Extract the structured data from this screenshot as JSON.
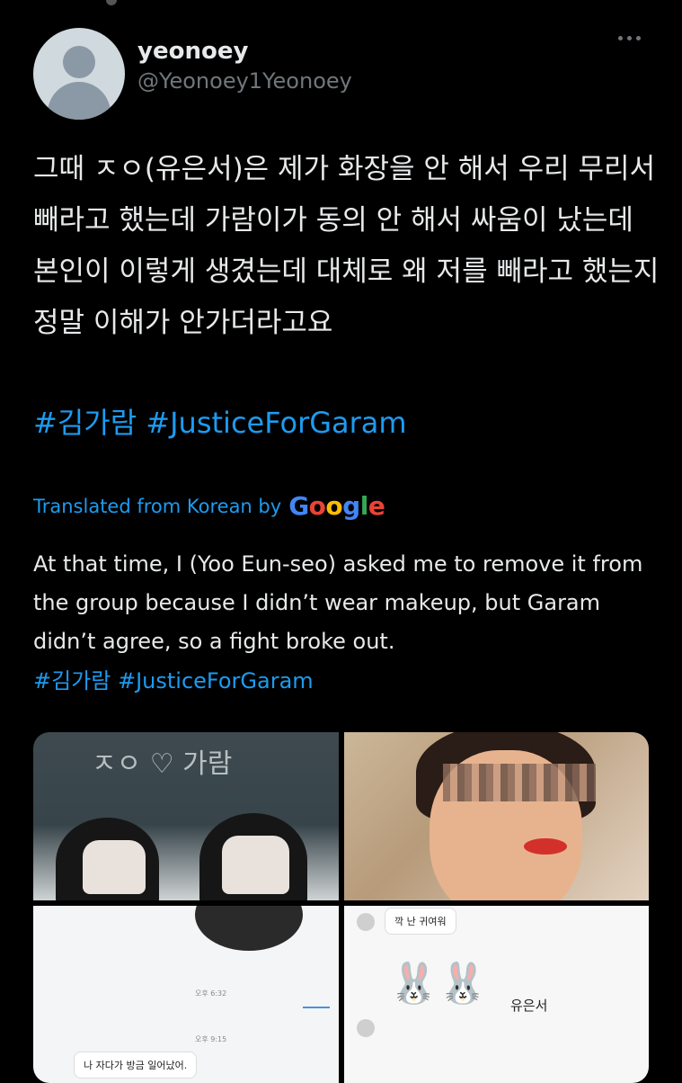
{
  "author": {
    "name": "yeonoey",
    "handle": "@Yeonoey1Yeonoey"
  },
  "tweet": {
    "text": "그때 ㅈㅇ(유은서)은 제가 화장을 안 해서 우리 무리서 빼라고 했는데 가람이가 동의 안 해서 싸움이 났는데 본인이 이렇게 생겼는데 대체로 왜 저를 빼라고 했는지 정말 이해가 안가더라고요",
    "hashtags": "#김가람 #JusticeForGaram"
  },
  "translation": {
    "label": "Translated from Korean by",
    "provider": "Google",
    "text": "At that time, I (Yoo Eun-seo) asked me to remove it from the group because I didn’t wear makeup, but Garam didn’t agree, so a fight broke out.",
    "hashtags": "#김가람 #JusticeForGaram"
  },
  "media": {
    "photo1_chalk": "ㅈㅇ ♡ 가람",
    "chat_time_1": "오후 6:32",
    "chat_time_2": "오후 9:15",
    "chat_message": "나 자다가 방금 일어났어.",
    "chat2_top": "깍 난 귀여워",
    "chat2_name": "유은서"
  },
  "colors": {
    "background": "#000000",
    "text": "#e7e9ea",
    "secondary": "#71767b",
    "link": "#1d9bf0"
  }
}
